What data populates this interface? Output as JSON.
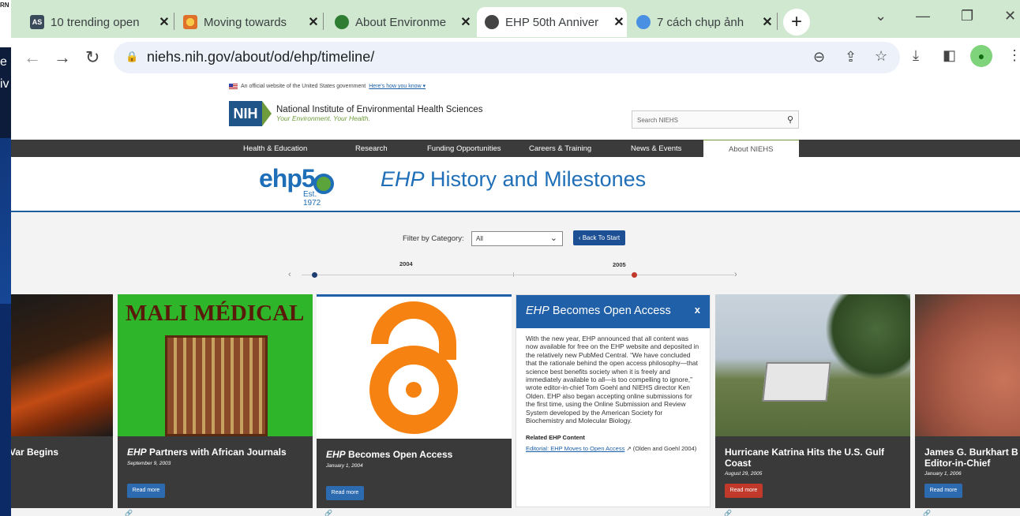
{
  "background_window": {
    "title_fragment": "RN",
    "side_text_1": "e",
    "side_text_2": "iv"
  },
  "browser": {
    "tabs": [
      {
        "favicon": "AS",
        "title": "10 trending open",
        "active": false
      },
      {
        "favicon": "",
        "title": "Moving towards",
        "active": false
      },
      {
        "favicon": "",
        "title": "About Environme",
        "active": false
      },
      {
        "favicon": "",
        "title": "EHP 50th Anniver",
        "active": true
      },
      {
        "favicon": "",
        "title": "7 cách chụp ảnh",
        "active": false
      }
    ],
    "close_glyph": "✕",
    "new_tab_glyph": "+",
    "url": "niehs.nih.gov/about/od/ehp/timeline/",
    "window_controls": {
      "dropdown": "⌄",
      "minimize": "—",
      "restore": "❐",
      "close": "✕"
    }
  },
  "site": {
    "gov_banner": "An official website of the United States government",
    "gov_link": "Here's how you know ▾",
    "nih": "NIH",
    "institute_name": "National Institute of Environmental Health Sciences",
    "tagline": "Your Environment. Your Health.",
    "search_placeholder": "Search NIEHS",
    "nav": [
      "Health & Education",
      "Research",
      "Funding Opportunities",
      "Careers & Training",
      "News & Events",
      "About NIEHS"
    ]
  },
  "timeline": {
    "logo_text": "ehp5",
    "logo_est": "Est. 1972",
    "title_em": "EHP",
    "title_rest": " History and Milestones",
    "filter_label": "Filter by Category:",
    "filter_value": "All",
    "back_button": "‹ Back To Start",
    "years": [
      "2004",
      "2005"
    ],
    "prev_arrow": "‹",
    "next_arrow": "›"
  },
  "cards": [
    {
      "title_em": "",
      "title": "Var Begins",
      "date": "",
      "button": ""
    },
    {
      "title_em": "EHP",
      "title": " Partners with African Journals",
      "date": "September 9, 2003",
      "button": "Read more",
      "image_text": "MALI MÉDICAL"
    },
    {
      "title_em": "EHP",
      "title": " Becomes Open Access",
      "date": "January 1, 2004",
      "button": "Read more"
    },
    {
      "title_em": "",
      "title": "Hurricane Katrina Hits the U.S. Gulf Coast",
      "date": "August 29, 2005",
      "button": "Read more"
    },
    {
      "title_em": "",
      "title": "James G. Burkhart B Editor-in-Chief",
      "date": "January 1, 2006",
      "button": "Read more"
    }
  ],
  "popup": {
    "title_em": "EHP",
    "title": " Becomes Open Access",
    "close": "x",
    "body": "With the new year, EHP announced that all content was now available for free on the EHP website and deposited in the relatively new PubMed Central. “We have concluded that the rationale behind the open access philosophy—that science best benefits society when it is freely and immediately available to all—is too compelling to ignore,” wrote editor-in-chief Tom Goehl and NIEHS director Ken Olden. EHP also began accepting online submissions for the first time, using the Online Submission and Review System developed by the American Society for Biochemistry and Molecular Biology.",
    "related_label": "Related EHP Content",
    "related_link": "Editorial: EHP Moves to Open Access",
    "related_suffix": " ↗ (Olden and Goehl 2004)"
  },
  "colors": {
    "nih_blue": "#20558a",
    "ehp_blue": "#1f6fb8",
    "popup_header": "#2060a8",
    "nav_bar": "#3b3b3b",
    "dot_past": "#1d3d70",
    "dot_current": "#c0392b",
    "read_more_red": "#c0392b"
  }
}
